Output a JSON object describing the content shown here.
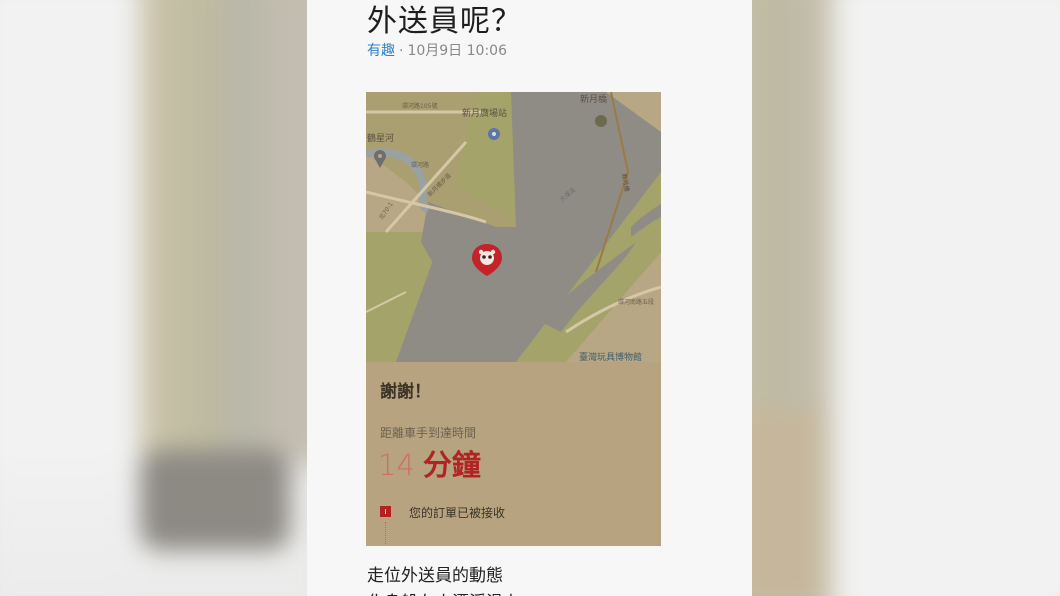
{
  "article": {
    "title": "外送員呢？",
    "category": "有趣",
    "separator": "·",
    "date": "10月9日 10:06",
    "paragraphs": [
      "走位外送員的動態",
      "化身躲在小漂浮滑上"
    ]
  },
  "screenshot": {
    "map": {
      "labels": {
        "station": "新月廣場站",
        "bridge": "新月橋",
        "river_park": "鶴星河",
        "museum": "臺灣玩具博物館",
        "road_top": "環河路105號",
        "road_left": "北70-1",
        "road_mid": "環河路",
        "road_curve": "新月橋步道",
        "road_right": "新月橋",
        "road_lower_right": "環河南路五段",
        "river": "大漢溪"
      },
      "marker_icon": "panda-pin-icon"
    },
    "card": {
      "thanks": "謝謝！",
      "eta_label": "距離車手到達時間",
      "eta_value": "14",
      "eta_unit": "分鐘",
      "status_icon": "receipt-icon",
      "status_text": "您的訂單已被接收"
    }
  }
}
